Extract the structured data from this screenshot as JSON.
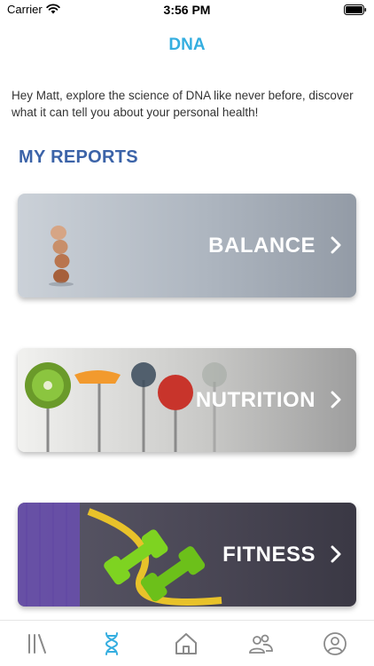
{
  "status_bar": {
    "carrier": "Carrier",
    "time": "3:56 PM"
  },
  "header": {
    "title": "DNA"
  },
  "intro": {
    "text": "Hey Matt, explore the science of DNA like never before, discover what it can tell you about your personal health!"
  },
  "reports": {
    "section_title": "MY REPORTS",
    "items": [
      {
        "label": "BALANCE",
        "image": "stacked-eggs"
      },
      {
        "label": "NUTRITION",
        "image": "fruit-on-forks"
      },
      {
        "label": "FITNESS",
        "image": "dumbbells-and-tape"
      }
    ]
  },
  "tab_bar": {
    "accent_color": "#35aee0",
    "inactive_color": "#8a8a8a",
    "items": [
      {
        "icon": "library-icon",
        "active": false
      },
      {
        "icon": "dna-icon",
        "active": true
      },
      {
        "icon": "home-icon",
        "active": false
      },
      {
        "icon": "community-icon",
        "active": false
      },
      {
        "icon": "profile-icon",
        "active": false
      }
    ]
  }
}
